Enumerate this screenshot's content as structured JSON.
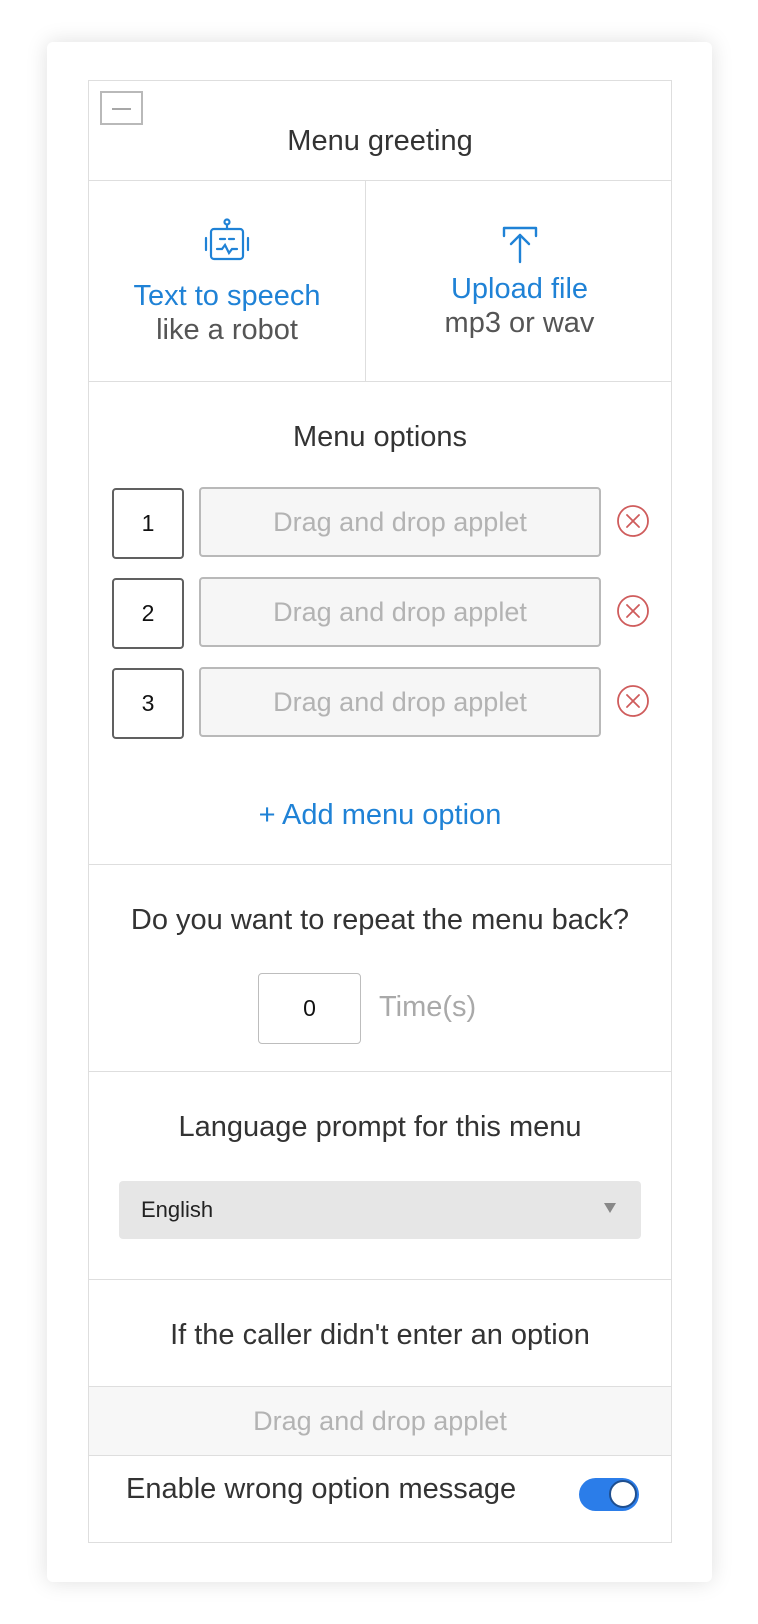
{
  "greeting": {
    "title": "Menu greeting",
    "tts": {
      "title": "Text to speech",
      "subtitle": "like a robot",
      "icon": "robot-icon"
    },
    "upload": {
      "title": "Upload file",
      "subtitle": "mp3 or wav",
      "icon": "upload-icon"
    }
  },
  "menu_options": {
    "title": "Menu options",
    "items": [
      {
        "number": "1",
        "placeholder": "Drag and drop applet"
      },
      {
        "number": "2",
        "placeholder": "Drag and drop applet"
      },
      {
        "number": "3",
        "placeholder": "Drag and drop applet"
      }
    ],
    "add_label": "+ Add menu option"
  },
  "repeat": {
    "question": "Do you want to repeat the menu back?",
    "value": "0",
    "unit": "Time(s)"
  },
  "language": {
    "title": "Language prompt for this menu",
    "selected": "English"
  },
  "fallback": {
    "title": "If the caller didn't enter an option",
    "placeholder": "Drag and drop applet"
  },
  "wrong_option": {
    "label": "Enable wrong option message",
    "enabled": true
  },
  "colors": {
    "accent": "#1f82d6",
    "toggle_on": "#2b7de9",
    "remove": "#cf5c5c"
  }
}
